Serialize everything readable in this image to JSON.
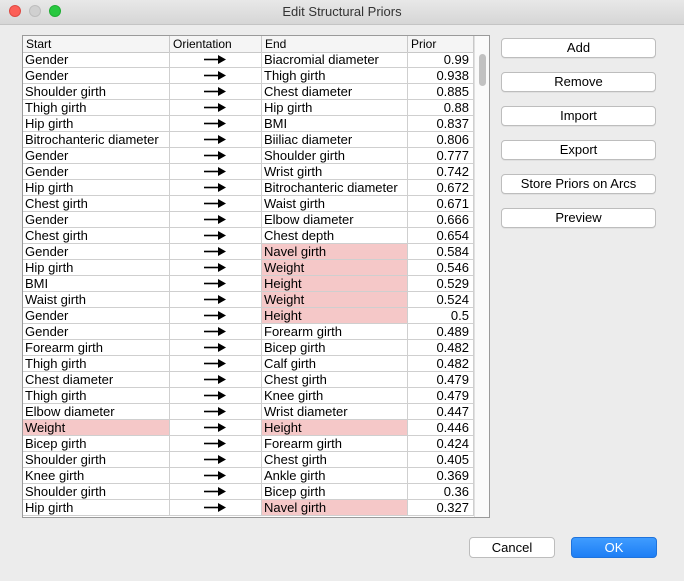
{
  "window": {
    "title": "Edit Structural Priors"
  },
  "table": {
    "columns": [
      "Start",
      "Orientation",
      "End",
      "Prior"
    ],
    "rows": [
      {
        "start": "Gender",
        "end": "Biacromial diameter",
        "prior": "0.99",
        "hl_start": false,
        "hl_end": false
      },
      {
        "start": "Gender",
        "end": "Thigh girth",
        "prior": "0.938",
        "hl_start": false,
        "hl_end": false
      },
      {
        "start": "Shoulder girth",
        "end": "Chest diameter",
        "prior": "0.885",
        "hl_start": false,
        "hl_end": false
      },
      {
        "start": "Thigh girth",
        "end": "Hip girth",
        "prior": "0.88",
        "hl_start": false,
        "hl_end": false
      },
      {
        "start": "Hip girth",
        "end": "BMI",
        "prior": "0.837",
        "hl_start": false,
        "hl_end": false
      },
      {
        "start": "Bitrochanteric diameter",
        "end": "Biiliac diameter",
        "prior": "0.806",
        "hl_start": false,
        "hl_end": false
      },
      {
        "start": "Gender",
        "end": "Shoulder girth",
        "prior": "0.777",
        "hl_start": false,
        "hl_end": false
      },
      {
        "start": "Gender",
        "end": "Wrist girth",
        "prior": "0.742",
        "hl_start": false,
        "hl_end": false
      },
      {
        "start": "Hip girth",
        "end": "Bitrochanteric diameter",
        "prior": "0.672",
        "hl_start": false,
        "hl_end": false
      },
      {
        "start": "Chest girth",
        "end": "Waist girth",
        "prior": "0.671",
        "hl_start": false,
        "hl_end": false
      },
      {
        "start": "Gender",
        "end": "Elbow diameter",
        "prior": "0.666",
        "hl_start": false,
        "hl_end": false
      },
      {
        "start": "Chest girth",
        "end": "Chest depth",
        "prior": "0.654",
        "hl_start": false,
        "hl_end": false
      },
      {
        "start": "Gender",
        "end": "Navel girth",
        "prior": "0.584",
        "hl_start": false,
        "hl_end": true
      },
      {
        "start": "Hip girth",
        "end": "Weight",
        "prior": "0.546",
        "hl_start": false,
        "hl_end": true
      },
      {
        "start": "BMI",
        "end": "Height",
        "prior": "0.529",
        "hl_start": false,
        "hl_end": true
      },
      {
        "start": "Waist girth",
        "end": "Weight",
        "prior": "0.524",
        "hl_start": false,
        "hl_end": true
      },
      {
        "start": "Gender",
        "end": "Height",
        "prior": "0.5",
        "hl_start": false,
        "hl_end": true
      },
      {
        "start": "Gender",
        "end": "Forearm girth",
        "prior": "0.489",
        "hl_start": false,
        "hl_end": false
      },
      {
        "start": "Forearm girth",
        "end": "Bicep girth",
        "prior": "0.482",
        "hl_start": false,
        "hl_end": false
      },
      {
        "start": "Thigh girth",
        "end": "Calf girth",
        "prior": "0.482",
        "hl_start": false,
        "hl_end": false
      },
      {
        "start": "Chest diameter",
        "end": "Chest girth",
        "prior": "0.479",
        "hl_start": false,
        "hl_end": false
      },
      {
        "start": "Thigh girth",
        "end": "Knee girth",
        "prior": "0.479",
        "hl_start": false,
        "hl_end": false
      },
      {
        "start": "Elbow diameter",
        "end": "Wrist diameter",
        "prior": "0.447",
        "hl_start": false,
        "hl_end": false
      },
      {
        "start": "Weight",
        "end": "Height",
        "prior": "0.446",
        "hl_start": true,
        "hl_end": true
      },
      {
        "start": "Bicep girth",
        "end": "Forearm girth",
        "prior": "0.424",
        "hl_start": false,
        "hl_end": false
      },
      {
        "start": "Shoulder girth",
        "end": "Chest girth",
        "prior": "0.405",
        "hl_start": false,
        "hl_end": false
      },
      {
        "start": "Knee girth",
        "end": "Ankle girth",
        "prior": "0.369",
        "hl_start": false,
        "hl_end": false
      },
      {
        "start": "Shoulder girth",
        "end": "Bicep girth",
        "prior": "0.36",
        "hl_start": false,
        "hl_end": false
      },
      {
        "start": "Hip girth",
        "end": "Navel girth",
        "prior": "0.327",
        "hl_start": false,
        "hl_end": true
      }
    ],
    "orientation_icon": "right-arrow-icon",
    "highlight_color": "#f5c8c8"
  },
  "side_buttons": [
    "Add",
    "Remove",
    "Import",
    "Export",
    "Store Priors on Arcs",
    "Preview"
  ],
  "footer": {
    "cancel_label": "Cancel",
    "ok_label": "OK",
    "ok_color": "#1d7ef5"
  }
}
